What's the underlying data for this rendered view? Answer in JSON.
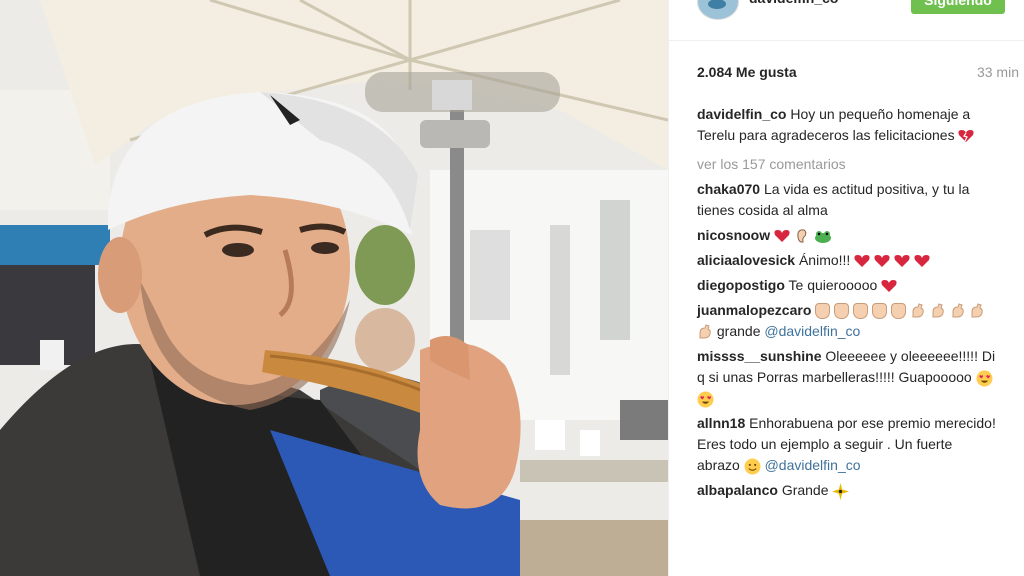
{
  "post": {
    "username": "davidelfin_co",
    "follow_label": "Siguiendo",
    "likes": "2.084 Me gusta",
    "time": "33 min",
    "caption_user": "davidelfin_co",
    "caption_text": "Hoy un pequeño homenaje a Terelu para agradeceros las felicitaciones",
    "view_all": "ver los 157 comentarios"
  },
  "comments": [
    {
      "user": "chaka070",
      "text": "La vida es actitud positiva, y tu la tienes cosida al alma"
    },
    {
      "user": "nicosnoow",
      "text": ""
    },
    {
      "user": "aliciaalovesick",
      "text": "Ánimo!!!"
    },
    {
      "user": "diegopostigo",
      "text": "Te quierooooo"
    },
    {
      "user": "juanmalopezcaro",
      "text": "grande",
      "mention": "@davidelfin_co"
    },
    {
      "user": "missss__sunshine",
      "text": "Oleeeeee y oleeeeee!!!!! Di q si unas Porras marbelleras!!!!! Guapooooo"
    },
    {
      "user": "allnn18",
      "text": "Enhorabuena por ese premio merecido! Eres todo un ejemplo a seguir . Un fuerte abrazo",
      "mention": "@davidelfin_co"
    },
    {
      "user": "albapalanco",
      "text": "Grande"
    }
  ],
  "icons": {
    "heart_color": "#d7263d",
    "follow_color": "#70c050",
    "link_color": "#3f729b"
  }
}
